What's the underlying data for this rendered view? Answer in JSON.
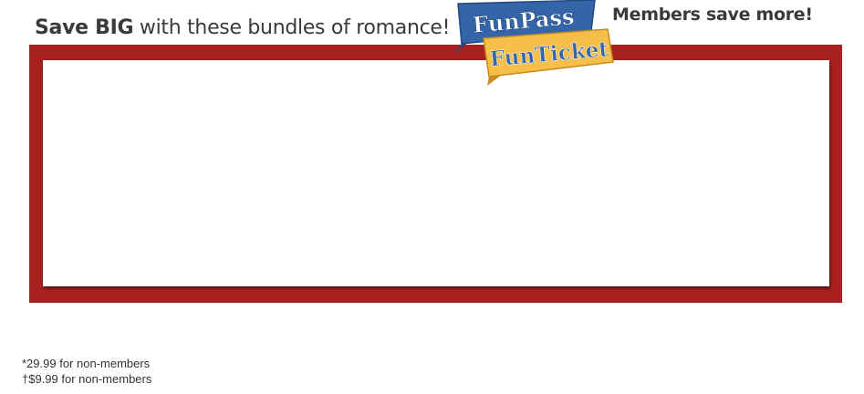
{
  "header": {
    "headline_bold": "Save BIG",
    "headline_rest": " with these bundles of romance!",
    "members_tagline": "Members save more!"
  },
  "logo": {
    "top_word": "FunPass",
    "bottom_word": "FunTicket",
    "colors": {
      "blue": "#3465a8",
      "gold": "#f6bf4a",
      "frame_red": "#a8201f"
    }
  },
  "footnotes": {
    "line1": "*29.99 for non-members",
    "line2": "†$9.99 for non-members"
  }
}
